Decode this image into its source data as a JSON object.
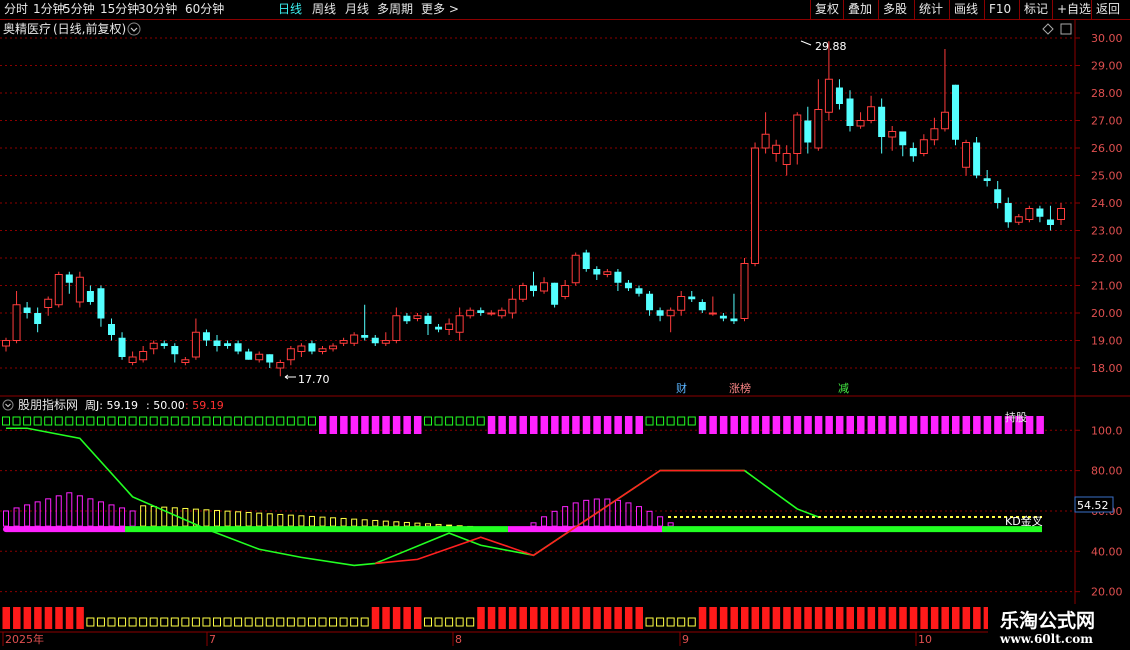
{
  "toolbar": {
    "left": [
      "分时",
      "1分钟",
      "5分钟",
      "15分钟",
      "30分钟",
      "60分钟",
      "日线",
      "周线",
      "月线",
      "多周期",
      "更多"
    ],
    "active": "日线",
    "right": [
      "复权",
      "叠加",
      "多股",
      "统计",
      "画线",
      "F10",
      "标记",
      "+自选",
      "返回"
    ]
  },
  "stock": {
    "name": "奥精医疗",
    "period_note": "(日线,前复权)"
  },
  "price_axis": [
    "30.00",
    "29.00",
    "28.00",
    "27.00",
    "26.00",
    "25.00",
    "24.00",
    "23.00",
    "22.00",
    "21.00",
    "20.00",
    "19.00",
    "18.00"
  ],
  "annotations": {
    "high": "29.88",
    "low": "17.70"
  },
  "event_tags": [
    {
      "text": "财",
      "color": "#5ab4ff"
    },
    {
      "text": "涨榜",
      "color": "#ff8888"
    },
    {
      "text": "减",
      "color": "#44ee44"
    }
  ],
  "indicator": {
    "name": "股朋指标网",
    "params": [
      {
        "text": "周J: 59.19",
        "color": "#ffffff"
      },
      {
        "text": ": 50.00",
        "color": "#ffffff"
      },
      {
        "text": ": 59.19",
        "color": "#ff3030"
      }
    ],
    "axis": [
      "100.0",
      "80.00",
      "60.00",
      "40.00",
      "20.00"
    ],
    "current_value": "54.52",
    "kd_label": "KD金叉",
    "top_right_label": "持股"
  },
  "date_axis": [
    "2025年",
    "7",
    "8",
    "9",
    "10"
  ],
  "watermark": {
    "name": "乐淘公式网",
    "url": "www.60lt.com"
  },
  "colors": {
    "up": "#ff3c3c",
    "down": "#54ffff",
    "grid": "#8b0000",
    "magenta": "#ff22ff",
    "green": "#22ff22",
    "yellow": "#ffff44"
  },
  "chart_data": {
    "type": "candlestick",
    "y_range": [
      17.4,
      30.6
    ],
    "candles": [
      [
        18.8,
        19.0,
        18.6,
        19.1
      ],
      [
        19.0,
        20.3,
        18.9,
        20.8
      ],
      [
        20.2,
        20.0,
        19.8,
        20.4
      ],
      [
        20.0,
        19.6,
        19.3,
        20.2
      ],
      [
        20.2,
        20.5,
        19.9,
        20.6
      ],
      [
        20.3,
        21.4,
        20.2,
        21.5
      ],
      [
        21.4,
        21.1,
        20.7,
        21.5
      ],
      [
        20.4,
        21.3,
        20.2,
        21.5
      ],
      [
        20.8,
        20.4,
        20.3,
        21.0
      ],
      [
        20.9,
        19.8,
        19.5,
        21.0
      ],
      [
        19.6,
        19.2,
        19.0,
        19.8
      ],
      [
        19.1,
        18.4,
        18.3,
        19.3
      ],
      [
        18.2,
        18.4,
        18.1,
        18.6
      ],
      [
        18.3,
        18.6,
        18.2,
        18.8
      ],
      [
        18.7,
        18.9,
        18.5,
        19.0
      ],
      [
        18.9,
        18.8,
        18.7,
        19.0
      ],
      [
        18.8,
        18.5,
        18.2,
        18.9
      ],
      [
        18.2,
        18.3,
        18.1,
        18.4
      ],
      [
        18.4,
        19.3,
        18.3,
        19.8
      ],
      [
        19.3,
        19.0,
        18.8,
        19.4
      ],
      [
        19.0,
        18.8,
        18.6,
        19.2
      ],
      [
        18.9,
        18.8,
        18.7,
        19.0
      ],
      [
        18.9,
        18.6,
        18.5,
        19.0
      ],
      [
        18.6,
        18.3,
        18.3,
        18.7
      ],
      [
        18.3,
        18.5,
        18.2,
        18.6
      ],
      [
        18.5,
        18.2,
        18.0,
        18.5
      ],
      [
        18.0,
        18.2,
        17.7,
        18.3
      ],
      [
        18.3,
        18.7,
        18.1,
        18.8
      ],
      [
        18.6,
        18.8,
        18.4,
        18.9
      ],
      [
        18.9,
        18.6,
        18.5,
        19.0
      ],
      [
        18.6,
        18.7,
        18.5,
        18.8
      ],
      [
        18.7,
        18.8,
        18.6,
        18.9
      ],
      [
        18.9,
        19.0,
        18.8,
        19.1
      ],
      [
        18.9,
        19.2,
        18.8,
        19.3
      ],
      [
        19.2,
        19.1,
        19.0,
        20.3
      ],
      [
        19.1,
        18.9,
        18.8,
        19.2
      ],
      [
        18.9,
        19.0,
        18.8,
        19.3
      ],
      [
        19.0,
        19.9,
        18.9,
        20.2
      ],
      [
        19.9,
        19.7,
        19.6,
        20.0
      ],
      [
        19.8,
        19.9,
        19.7,
        20.0
      ],
      [
        19.9,
        19.6,
        19.2,
        20.0
      ],
      [
        19.5,
        19.4,
        19.3,
        19.6
      ],
      [
        19.4,
        19.6,
        19.2,
        19.8
      ],
      [
        19.3,
        19.9,
        19.0,
        20.2
      ],
      [
        19.9,
        20.1,
        19.8,
        20.2
      ],
      [
        20.1,
        20.0,
        19.9,
        20.2
      ],
      [
        20.0,
        20.0,
        19.9,
        20.1
      ],
      [
        19.9,
        20.1,
        19.8,
        20.2
      ],
      [
        20.0,
        20.5,
        19.8,
        20.9
      ],
      [
        20.5,
        21.0,
        20.4,
        21.1
      ],
      [
        21.0,
        20.8,
        20.6,
        21.5
      ],
      [
        20.8,
        21.1,
        20.7,
        21.3
      ],
      [
        21.1,
        20.3,
        20.2,
        21.1
      ],
      [
        20.6,
        21.0,
        20.5,
        21.2
      ],
      [
        21.1,
        22.1,
        21.0,
        22.2
      ],
      [
        22.2,
        21.6,
        21.5,
        22.3
      ],
      [
        21.6,
        21.4,
        21.2,
        21.7
      ],
      [
        21.4,
        21.5,
        21.3,
        21.6
      ],
      [
        21.5,
        21.1,
        20.8,
        21.6
      ],
      [
        21.1,
        20.9,
        20.8,
        21.2
      ],
      [
        20.9,
        20.7,
        20.6,
        21.0
      ],
      [
        20.7,
        20.1,
        19.9,
        20.8
      ],
      [
        20.1,
        19.9,
        19.7,
        20.2
      ],
      [
        19.9,
        20.1,
        19.3,
        20.2
      ],
      [
        20.1,
        20.6,
        19.9,
        20.8
      ],
      [
        20.6,
        20.5,
        20.4,
        20.8
      ],
      [
        20.4,
        20.1,
        20.0,
        20.5
      ],
      [
        20.0,
        20.0,
        19.9,
        20.6
      ],
      [
        19.9,
        19.8,
        19.7,
        20.0
      ],
      [
        19.8,
        19.7,
        19.6,
        20.7
      ],
      [
        19.8,
        21.8,
        19.7,
        22.0
      ],
      [
        21.8,
        26.0,
        21.7,
        26.2
      ],
      [
        26.0,
        26.5,
        25.8,
        27.3
      ],
      [
        25.8,
        26.1,
        25.5,
        26.3
      ],
      [
        25.4,
        25.8,
        25.0,
        26.1
      ],
      [
        25.8,
        27.2,
        25.4,
        27.3
      ],
      [
        27.0,
        26.2,
        25.8,
        27.5
      ],
      [
        26.0,
        27.4,
        25.9,
        28.5
      ],
      [
        27.3,
        28.5,
        27.0,
        29.88
      ],
      [
        28.2,
        27.6,
        27.4,
        28.5
      ],
      [
        27.8,
        26.8,
        26.6,
        28.1
      ],
      [
        26.8,
        27.0,
        26.7,
        27.3
      ],
      [
        27.0,
        27.5,
        26.9,
        27.9
      ],
      [
        27.5,
        26.4,
        25.8,
        27.8
      ],
      [
        26.4,
        26.6,
        25.9,
        26.8
      ],
      [
        26.6,
        26.1,
        25.7,
        26.6
      ],
      [
        26.0,
        25.7,
        25.5,
        26.2
      ],
      [
        25.8,
        26.3,
        25.7,
        26.5
      ],
      [
        26.3,
        26.7,
        26.1,
        27.1
      ],
      [
        26.7,
        27.3,
        26.6,
        29.6
      ],
      [
        28.3,
        26.3,
        26.1,
        28.3
      ],
      [
        25.3,
        26.2,
        25.0,
        26.3
      ],
      [
        26.2,
        25.0,
        24.9,
        26.4
      ],
      [
        24.9,
        24.8,
        24.6,
        25.2
      ],
      [
        24.5,
        24.0,
        23.8,
        24.8
      ],
      [
        24.0,
        23.3,
        23.1,
        24.2
      ],
      [
        23.3,
        23.5,
        23.2,
        23.6
      ],
      [
        23.4,
        23.8,
        23.3,
        23.9
      ],
      [
        23.8,
        23.5,
        23.3,
        23.9
      ],
      [
        23.4,
        23.2,
        23.0,
        23.9
      ],
      [
        23.4,
        23.8,
        23.2,
        24.0
      ]
    ],
    "indicator": {
      "axis_range": [
        0,
        115
      ],
      "green_line": [
        [
          0,
          101
        ],
        [
          2,
          101
        ],
        [
          7,
          96
        ],
        [
          12,
          67
        ],
        [
          19,
          51
        ],
        [
          24,
          41
        ],
        [
          28,
          37
        ],
        [
          33,
          33
        ],
        [
          35,
          34
        ],
        [
          42,
          49
        ],
        [
          45,
          43
        ],
        [
          50,
          38
        ],
        [
          56,
          59
        ],
        [
          62,
          80
        ],
        [
          70,
          80
        ],
        [
          75,
          61
        ],
        [
          77,
          57
        ]
      ],
      "red_line": [
        [
          35,
          34
        ],
        [
          39,
          36
        ],
        [
          45,
          47
        ],
        [
          50,
          38
        ],
        [
          56,
          59
        ],
        [
          62,
          80
        ],
        [
          70,
          80
        ]
      ],
      "yellow_dotted_level": 57,
      "bottom_band_level": 51
    }
  }
}
